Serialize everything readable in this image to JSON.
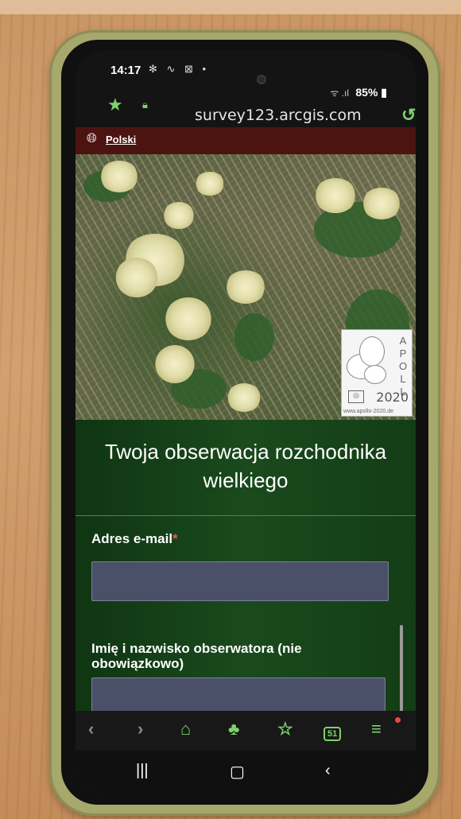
{
  "status_bar": {
    "time": "14:17",
    "notification_icons": "✻ ∿ ⊠ •",
    "signal_text": "ᯤ .ıl",
    "battery": "85%"
  },
  "browser": {
    "url": "survey123.arcgis.com"
  },
  "language": {
    "label": "Polski"
  },
  "photo_logo": {
    "apollo": "APOLL",
    "year": "2020",
    "url": "www.apollo-2020.de"
  },
  "form": {
    "title": "Twoja obserwacja rozchodnika wielkiego",
    "email_label": "Adres e-mail",
    "email_required_mark": "*",
    "email_value": "",
    "name_label": "Imię i nazwisko obserwatora (nie obowiązkowo)",
    "name_value": ""
  },
  "toolbar": {
    "tabs_count": "51"
  },
  "colors": {
    "accent": "#7cd36a",
    "lang_strip": "#4c1411",
    "form_bg": "#1a4a1d",
    "input_bg": "#4a5068",
    "required": "#e85a4f"
  }
}
